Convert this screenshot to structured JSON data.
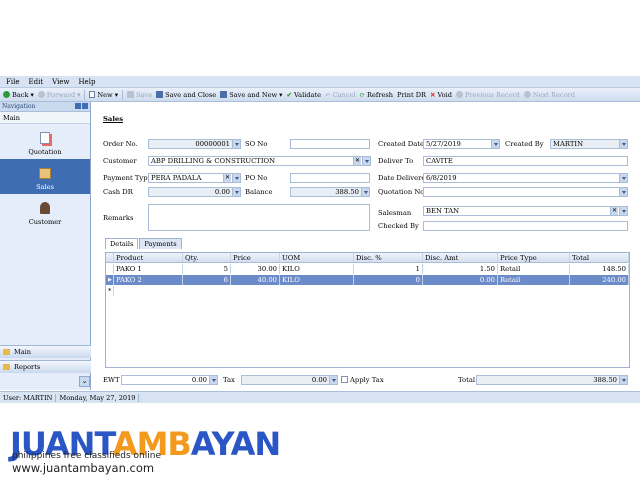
{
  "menu": {
    "items": [
      "File",
      "Edit",
      "View",
      "Help"
    ]
  },
  "toolbar": {
    "back": "Back",
    "forward": "Forward",
    "new": "New",
    "save": "Save",
    "save_close": "Save and Close",
    "save_new": "Save and New",
    "validate": "Validate",
    "cancel": "Cancel",
    "refresh": "Refresh",
    "print_dr": "Print DR",
    "void": "Void",
    "prev": "Previous Record",
    "next": "Next Record"
  },
  "nav": {
    "header": "Navigation",
    "section": "Main",
    "items": [
      "Quotation",
      "Sales",
      "Customer"
    ],
    "bottom_main": "Main",
    "bottom_reports": "Reports"
  },
  "form": {
    "title": "Sales",
    "order_no_label": "Order No.",
    "order_no": "00000001",
    "so_no_label": "SO No",
    "so_no": "",
    "created_date_label": "Created Date",
    "created_date": "5/27/2019",
    "created_by_label": "Created By",
    "created_by": "MARTIN",
    "customer_label": "Customer",
    "customer": "ABP DRILLING & CONSTRUCTION",
    "deliver_to_label": "Deliver To",
    "deliver_to": "CAVITE",
    "payment_type_label": "Payment Type",
    "payment_type": "PERA PADALA",
    "po_no_label": "PO No",
    "po_no": "",
    "date_delivered_label": "Date Delivered",
    "date_delivered": "6/8/2019",
    "cash_dr_label": "Cash DR",
    "cash_dr": "0.00",
    "balance_label": "Balance",
    "balance": "388.50",
    "quotation_no_label": "Quotation No",
    "quotation_no": "",
    "remarks_label": "Remarks",
    "remarks": "",
    "salesman_label": "Salesman",
    "salesman": "BEN TAN",
    "checked_by_label": "Checked By",
    "checked_by": ""
  },
  "tabs": [
    "Details",
    "Payments"
  ],
  "grid": {
    "columns": [
      "Product",
      "Qty.",
      "Price",
      "UOM",
      "Disc. %",
      "Disc. Amt",
      "Price Type",
      "Total"
    ],
    "rows": [
      [
        "PAKO 1",
        "5",
        "30.00",
        "KILO",
        "1",
        "1.50",
        "Retail",
        "148.50"
      ],
      [
        "PAKO 2",
        "6",
        "40.00",
        "KILO",
        "0",
        "0.00",
        "Retail",
        "240.00"
      ]
    ],
    "new_row_marker": "*"
  },
  "footer": {
    "ewt_label": "EWT",
    "ewt": "0.00",
    "tax_label": "Tax",
    "tax": "0.00",
    "apply_tax": "Apply Tax",
    "total_label": "Total",
    "total": "388.50"
  },
  "status": {
    "user": "User: MARTIN",
    "date": "Monday, May 27, 2019"
  },
  "branding": {
    "logo": "JUANTAMBAYAN",
    "tagline": "philippines free classifieds online",
    "url": "www.juantambayan.com"
  },
  "colors": {
    "accent": "#3f6db3",
    "selected_row": "#6b8cc9",
    "logo_blue": "#2a56c6",
    "logo_orange": "#f29a1d"
  }
}
